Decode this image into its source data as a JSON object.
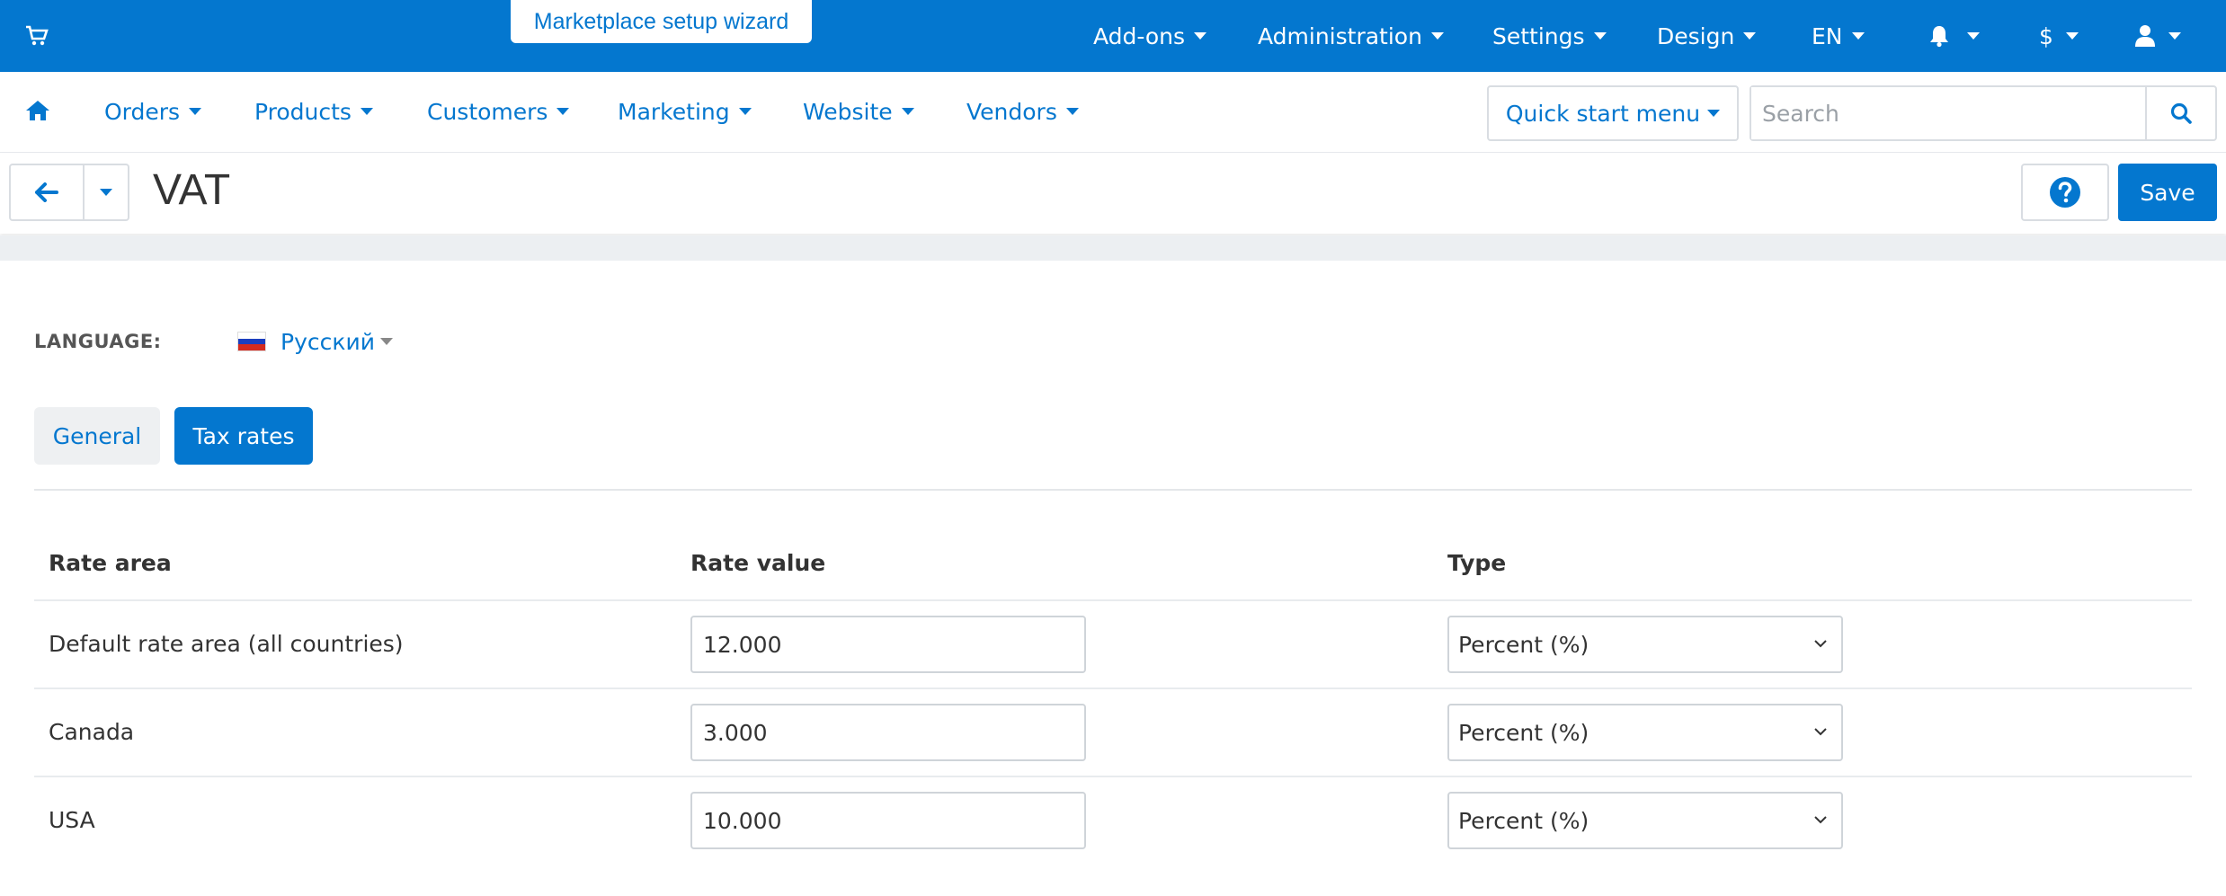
{
  "topbar": {
    "wizard_label": "Marketplace setup wizard",
    "items": [
      {
        "label": "Add-ons"
      },
      {
        "label": "Administration"
      },
      {
        "label": "Settings"
      },
      {
        "label": "Design"
      },
      {
        "label": "EN"
      },
      {
        "label": "$"
      }
    ]
  },
  "mainnav": {
    "items": [
      {
        "label": "Orders"
      },
      {
        "label": "Products"
      },
      {
        "label": "Customers"
      },
      {
        "label": "Marketing"
      },
      {
        "label": "Website"
      },
      {
        "label": "Vendors"
      }
    ],
    "quick_start_label": "Quick start menu",
    "search_placeholder": "Search"
  },
  "page": {
    "title": "VAT",
    "save_label": "Save"
  },
  "language": {
    "label": "LANGUAGE:",
    "selected": "Русский"
  },
  "tabs": [
    {
      "label": "General",
      "active": false
    },
    {
      "label": "Tax rates",
      "active": true
    }
  ],
  "table": {
    "headers": [
      "Rate area",
      "Rate value",
      "Type"
    ],
    "rows": [
      {
        "area": "Default rate area (all countries)",
        "value": "12.000",
        "type": "Percent (%)"
      },
      {
        "area": "Canada",
        "value": "3.000",
        "type": "Percent (%)"
      },
      {
        "area": "USA",
        "value": "10.000",
        "type": "Percent (%)"
      }
    ]
  },
  "colors": {
    "brand": "#0477cf",
    "background": "#ffffff",
    "band": "#eceff2"
  }
}
